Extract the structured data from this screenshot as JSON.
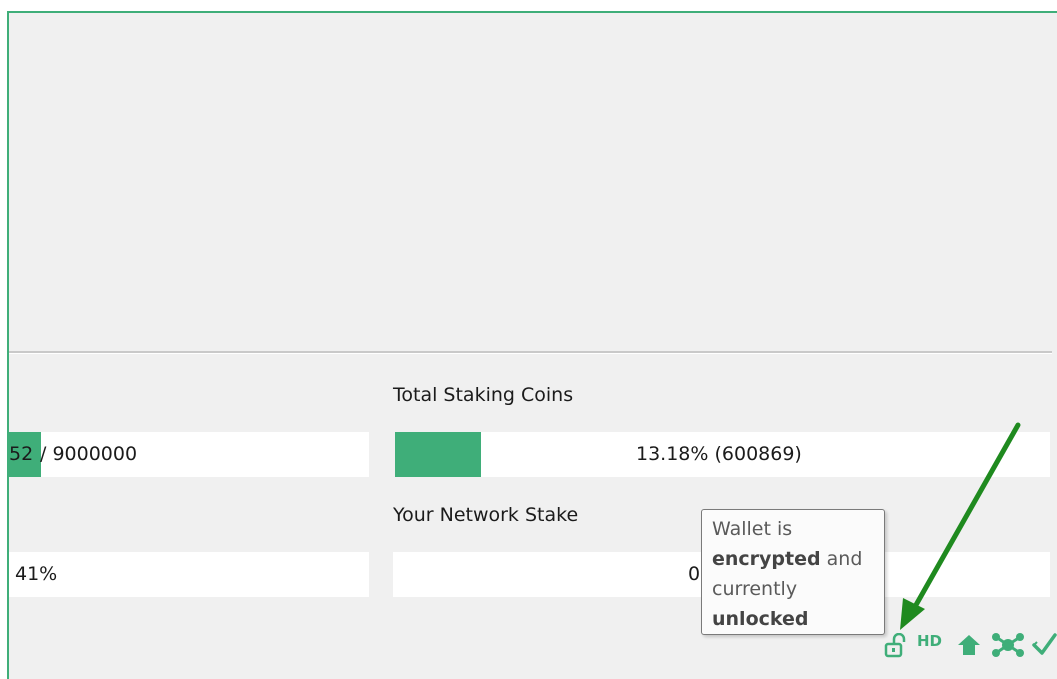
{
  "staking": {
    "total_label": "Total Staking Coins",
    "total_value": "13.18% (600869)",
    "total_fraction": 0.1318,
    "network_stake_label": "Your Network Stake",
    "network_stake_value": "0",
    "left_supply_partial": "52",
    "left_supply_max": "/ 9000000",
    "left_percent": "41%"
  },
  "tooltip": {
    "line1": "Wallet is",
    "bold1": "encrypted",
    "after_bold1": " and",
    "line3": "currently",
    "bold2": "unlocked"
  },
  "statusbar": {
    "hd_label": "HD",
    "icons": [
      "lock-open-icon",
      "hd-icon",
      "staking-icon",
      "network-icon",
      "synced-check-icon"
    ]
  },
  "colors": {
    "accent": "#3fae79",
    "arrow": "#1f8a1f"
  }
}
